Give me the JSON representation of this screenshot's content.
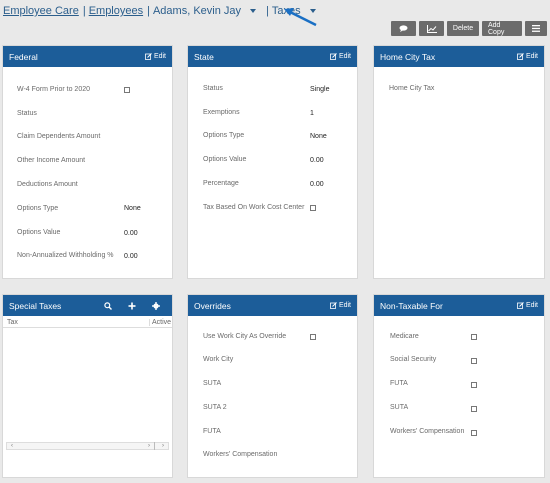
{
  "breadcrumb": {
    "link1": "Employee Care",
    "link2": "Employees",
    "employee": "Adams, Kevin Jay",
    "section": "Taxes"
  },
  "toolbar": {
    "comment_icon": "comment-icon",
    "chart_icon": "chart-icon",
    "delete": "Delete",
    "add_copy": "Add Copy",
    "menu_icon": "menu-icon"
  },
  "edit_label": "Edit",
  "federal": {
    "title": "Federal",
    "w4_label": "W-4 Form Prior to 2020",
    "status_label": "Status",
    "claim_label": "Claim Dependents Amount",
    "other_label": "Other Income Amount",
    "deductions_label": "Deductions Amount",
    "options_type_label": "Options Type",
    "options_type_value": "None",
    "options_value_label": "Options Value",
    "options_value_value": "0.00",
    "nonannual_label": "Non-Annualized Withholding %",
    "nonannual_value": "0.00"
  },
  "state": {
    "title": "State",
    "status_label": "Status",
    "status_value": "Single",
    "exemptions_label": "Exemptions",
    "exemptions_value": "1",
    "options_type_label": "Options Type",
    "options_type_value": "None",
    "options_value_label": "Options Value",
    "options_value_value": "0.00",
    "percentage_label": "Percentage",
    "percentage_value": "0.00",
    "tax_based_label": "Tax Based On Work Cost Center"
  },
  "home_city": {
    "title": "Home City Tax",
    "label": "Home City Tax"
  },
  "special": {
    "title": "Special Taxes",
    "col_tax": "Tax",
    "col_active": "Active"
  },
  "overrides": {
    "title": "Overrides",
    "use_work_city": "Use Work City As Override",
    "work_city": "Work City",
    "suta": "SUTA",
    "suta2": "SUTA 2",
    "futa": "FUTA",
    "workers_comp": "Workers' Compensation"
  },
  "nontaxable": {
    "title": "Non-Taxable For",
    "medicare": "Medicare",
    "social_security": "Social Security",
    "futa": "FUTA",
    "suta": "SUTA",
    "workers_comp": "Workers' Compensation"
  },
  "colors": {
    "header": "#1c5d99",
    "link": "#2b5e8c",
    "button": "#6b6b6b"
  }
}
